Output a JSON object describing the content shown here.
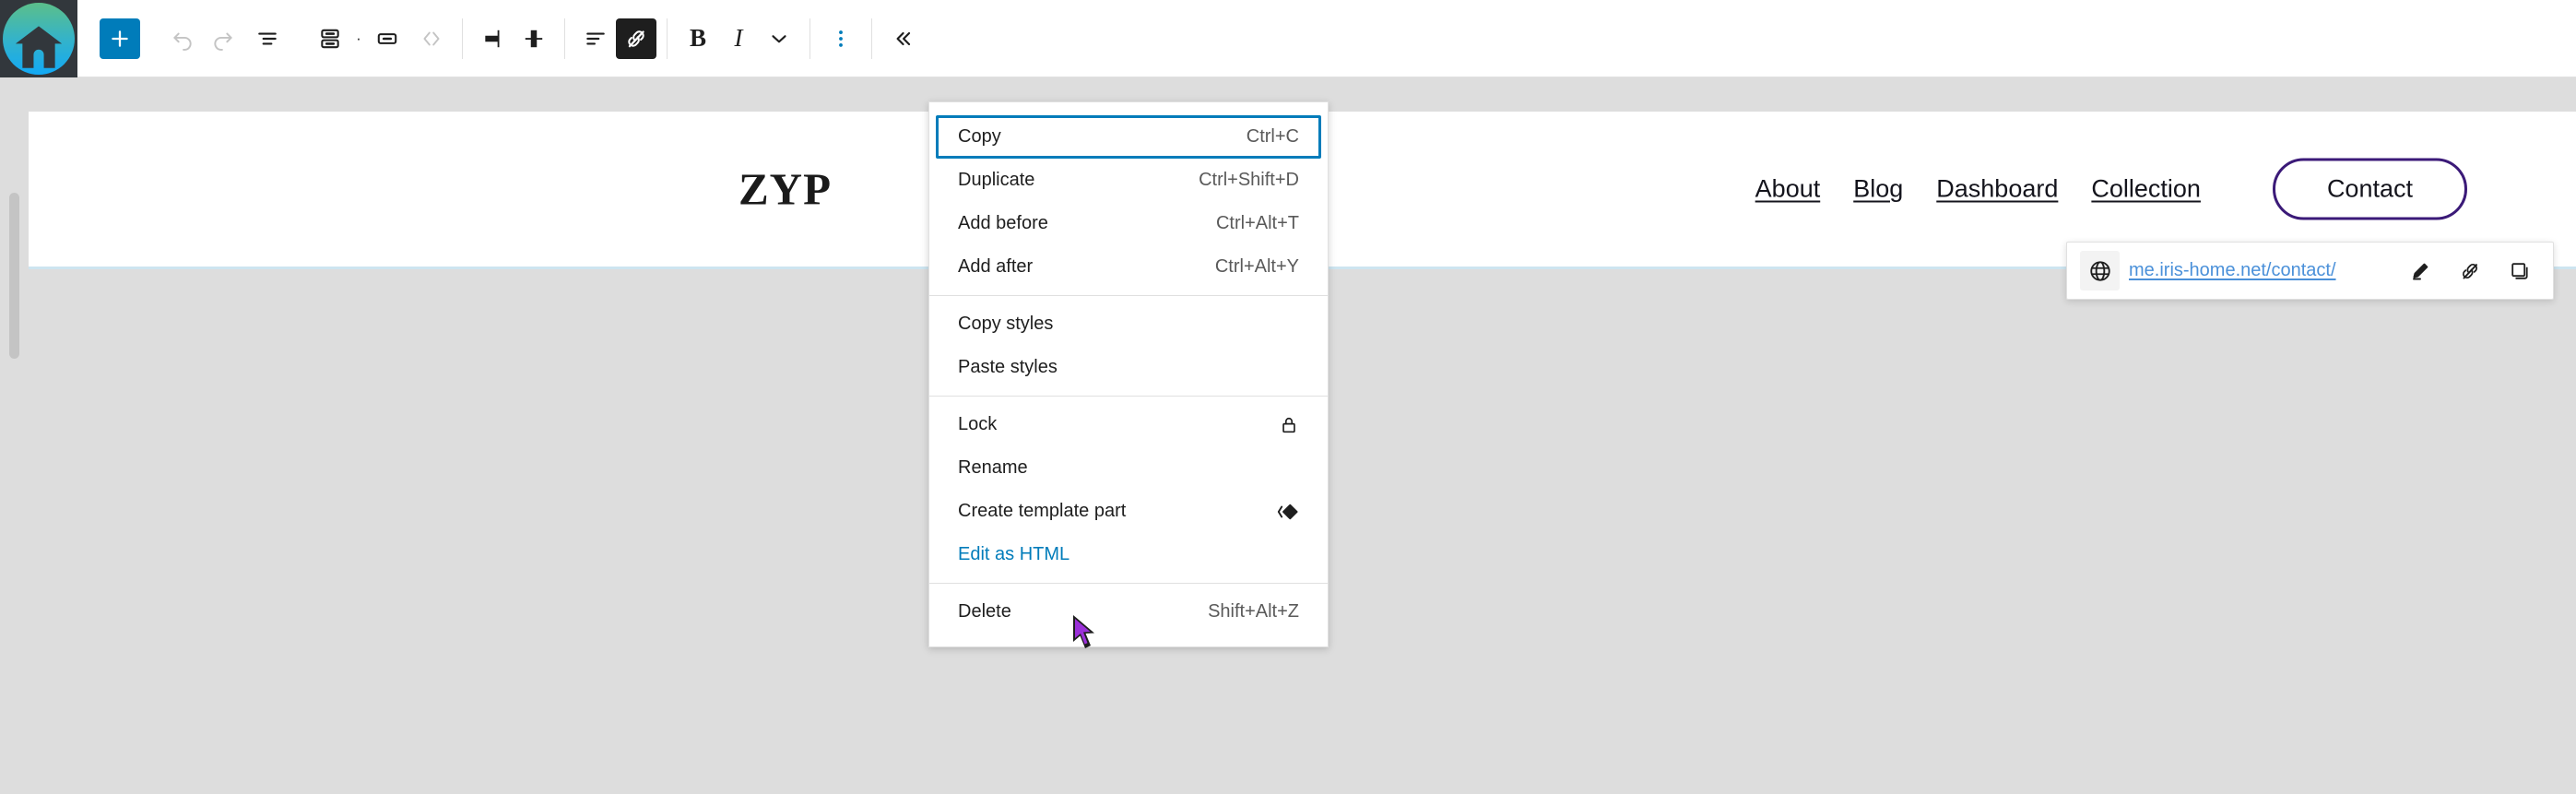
{
  "toolbar": {
    "site_icon": "house-icon",
    "buttons": [
      {
        "name": "add-block-button",
        "icon": "plus-icon",
        "label": "Add block"
      },
      {
        "name": "undo-button",
        "icon": "undo-arrow-icon",
        "label": "Undo"
      },
      {
        "name": "redo-button",
        "icon": "redo-arrow-icon",
        "label": "Redo"
      },
      {
        "name": "document-overview-button",
        "icon": "list-view-icon",
        "label": "Document Overview"
      },
      {
        "name": "block-type-button",
        "icon": "navigation-block-icon",
        "label": "Navigation"
      },
      {
        "name": "select-parent-button",
        "icon": "button-block-icon",
        "label": "Button"
      },
      {
        "name": "parent-block-button",
        "icon": "angle-brackets-icon",
        "label": "Select parent block"
      },
      {
        "name": "align-left-button",
        "icon": "align-left-icon",
        "label": "Align"
      },
      {
        "name": "align-center-button",
        "icon": "align-center-icon",
        "label": "Align center"
      },
      {
        "name": "text-align-button",
        "icon": "text-align-icon",
        "label": "Align text"
      },
      {
        "name": "link-button",
        "icon": "link-off-icon",
        "label": "Link"
      },
      {
        "name": "bold-button",
        "icon": "bold-icon",
        "label": "Bold"
      },
      {
        "name": "italic-button",
        "icon": "italic-icon",
        "label": "Italic"
      },
      {
        "name": "more-rich-text-button",
        "icon": "chevron-down-icon",
        "label": "More"
      },
      {
        "name": "block-options-button",
        "icon": "vertical-dots-icon",
        "label": "Options"
      },
      {
        "name": "collapse-toolbar-button",
        "icon": "double-chevron-left-icon",
        "label": "Collapse"
      }
    ],
    "bold_label": "B",
    "italic_label": "I",
    "dot_label": "·"
  },
  "site": {
    "logo": "ZYP",
    "nav_links": [
      {
        "label": "About"
      },
      {
        "label": "Blog"
      },
      {
        "label": "Dashboard"
      },
      {
        "label": "Collection"
      }
    ],
    "contact_button": "Contact"
  },
  "block_menu": {
    "groups": [
      {
        "items": [
          {
            "label": "Copy",
            "shortcut": "Ctrl+C",
            "focused": true
          },
          {
            "label": "Duplicate",
            "shortcut": "Ctrl+Shift+D"
          },
          {
            "label": "Add before",
            "shortcut": "Ctrl+Alt+T"
          },
          {
            "label": "Add after",
            "shortcut": "Ctrl+Alt+Y"
          }
        ]
      },
      {
        "items": [
          {
            "label": "Copy styles",
            "shortcut": ""
          },
          {
            "label": "Paste styles",
            "shortcut": ""
          }
        ]
      },
      {
        "items": [
          {
            "label": "Lock",
            "shortcut": "",
            "icon": "lock-icon"
          },
          {
            "label": "Rename",
            "shortcut": ""
          },
          {
            "label": "Create template part",
            "shortcut": "",
            "icon": "template-part-icon"
          },
          {
            "label": "Edit as HTML",
            "shortcut": "",
            "is_link": true
          }
        ]
      },
      {
        "items": [
          {
            "label": "Delete",
            "shortcut": "Shift+Alt+Z"
          }
        ]
      }
    ]
  },
  "link_popover": {
    "globe_icon": "globe-icon",
    "url": "me.iris-home.net/contact/",
    "actions": [
      {
        "name": "edit-link-button",
        "icon": "pencil-icon"
      },
      {
        "name": "unlink-button",
        "icon": "link-off-icon"
      },
      {
        "name": "copy-link-button",
        "icon": "copy-icon"
      }
    ]
  },
  "colors": {
    "accent_blue": "#007cba",
    "link_blue": "#4a90d9",
    "brand_purple": "#3b1a78",
    "canvas_gray": "#dddddd",
    "dark": "#1e1e1e"
  }
}
